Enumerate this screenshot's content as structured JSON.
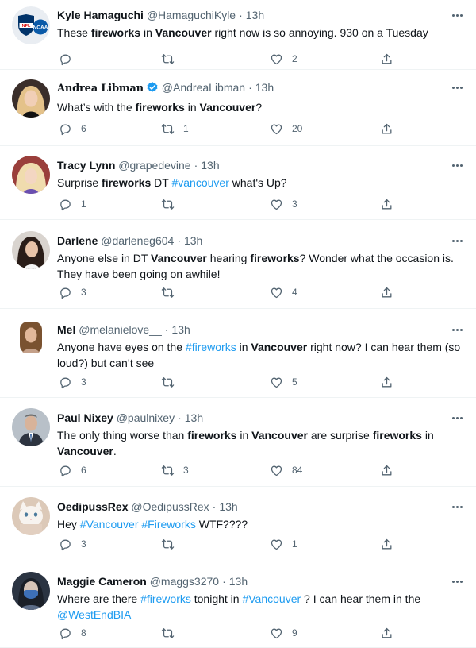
{
  "tweets": [
    {
      "name": "Kyle Hamaguchi",
      "handle": "@HamaguchiKyle",
      "time": "13h",
      "verified": false,
      "serif": false,
      "avatar": "nfl-ncaa-logo",
      "segments": [
        {
          "t": "These ",
          "s": "plain"
        },
        {
          "t": "fireworks",
          "s": "bold"
        },
        {
          "t": " in ",
          "s": "plain"
        },
        {
          "t": "Vancouver",
          "s": "bold"
        },
        {
          "t": " right now is so annoying. 930 on a Tuesday",
          "s": "plain"
        }
      ],
      "replies": "",
      "retweets": "",
      "likes": "2"
    },
    {
      "name": "Andrea Libman",
      "handle": "@AndreaLibman",
      "time": "13h",
      "verified": true,
      "serif": true,
      "avatar": "photo-blonde",
      "segments": [
        {
          "t": "What’s with the ",
          "s": "plain"
        },
        {
          "t": "fireworks",
          "s": "bold"
        },
        {
          "t": " in ",
          "s": "plain"
        },
        {
          "t": "Vancouver",
          "s": "bold"
        },
        {
          "t": "?",
          "s": "plain"
        }
      ],
      "replies": "6",
      "retweets": "1",
      "likes": "20"
    },
    {
      "name": "Tracy Lynn",
      "handle": "@grapedevine",
      "time": "13h",
      "verified": false,
      "serif": false,
      "avatar": "photo-blonde-2",
      "segments": [
        {
          "t": "Surprise ",
          "s": "plain"
        },
        {
          "t": "fireworks",
          "s": "bold"
        },
        {
          "t": " DT ",
          "s": "plain"
        },
        {
          "t": "#vancouver",
          "s": "tag"
        },
        {
          "t": " what's Up?",
          "s": "plain"
        }
      ],
      "replies": "1",
      "retweets": "",
      "likes": "3"
    },
    {
      "name": "Darlene",
      "handle": "@darleneg604",
      "time": "13h",
      "verified": false,
      "serif": false,
      "avatar": "photo-dark-hair",
      "segments": [
        {
          "t": "Anyone else in DT ",
          "s": "plain"
        },
        {
          "t": "Vancouver",
          "s": "bold"
        },
        {
          "t": " hearing ",
          "s": "plain"
        },
        {
          "t": "fireworks",
          "s": "bold"
        },
        {
          "t": "?  Wonder what the occasion is. They have been going on awhile!",
          "s": "plain"
        }
      ],
      "replies": "3",
      "retweets": "",
      "likes": "4"
    },
    {
      "name": "Mel",
      "handle": "@melanielove__",
      "time": "13h",
      "verified": false,
      "serif": false,
      "avatar": "photo-brown-hair",
      "segments": [
        {
          "t": "Anyone have eyes on the ",
          "s": "plain"
        },
        {
          "t": "#fireworks",
          "s": "tag"
        },
        {
          "t": " in ",
          "s": "plain"
        },
        {
          "t": "Vancouver",
          "s": "bold"
        },
        {
          "t": " right now? I can hear them (so loud?) but can’t see",
          "s": "plain"
        }
      ],
      "replies": "3",
      "retweets": "",
      "likes": "5"
    },
    {
      "name": "Paul Nixey",
      "handle": "@paulnixey",
      "time": "13h",
      "verified": false,
      "serif": false,
      "avatar": "photo-man-suit",
      "segments": [
        {
          "t": "The only thing worse than ",
          "s": "plain"
        },
        {
          "t": "fireworks",
          "s": "bold"
        },
        {
          "t": " in ",
          "s": "plain"
        },
        {
          "t": "Vancouver",
          "s": "bold"
        },
        {
          "t": " are surprise ",
          "s": "plain"
        },
        {
          "t": "fireworks",
          "s": "bold"
        },
        {
          "t": " in ",
          "s": "plain"
        },
        {
          "t": "Vancouver",
          "s": "bold"
        },
        {
          "t": ".",
          "s": "plain"
        }
      ],
      "replies": "6",
      "retweets": "3",
      "likes": "84"
    },
    {
      "name": "OedipussRex",
      "handle": "@OedipussRex",
      "time": "13h",
      "verified": false,
      "serif": false,
      "avatar": "photo-cat",
      "segments": [
        {
          "t": "Hey ",
          "s": "plain"
        },
        {
          "t": "#Vancouver",
          "s": "tag"
        },
        {
          "t": " ",
          "s": "plain"
        },
        {
          "t": "#Fireworks",
          "s": "tag"
        },
        {
          "t": " WTF????",
          "s": "plain"
        }
      ],
      "replies": "3",
      "retweets": "",
      "likes": "1"
    },
    {
      "name": "Maggie Cameron",
      "handle": "@maggs3270",
      "time": "13h",
      "verified": false,
      "serif": false,
      "avatar": "photo-masked",
      "segments": [
        {
          "t": "Where are there ",
          "s": "plain"
        },
        {
          "t": "#fireworks",
          "s": "tag"
        },
        {
          "t": " tonight in ",
          "s": "plain"
        },
        {
          "t": "#Vancouver",
          "s": "tag"
        },
        {
          "t": " ? I can hear them in the ",
          "s": "plain"
        },
        {
          "t": "@WestEndBIA",
          "s": "tag"
        }
      ],
      "replies": "8",
      "retweets": "",
      "likes": "9"
    }
  ],
  "colors": {
    "text": "#0f1419",
    "secondary": "#536471",
    "link": "#1d9bf0",
    "divider": "#eff3f4",
    "verified": "#1d9bf0"
  },
  "icons": {
    "reply": "reply-icon",
    "retweet": "retweet-icon",
    "like": "like-icon",
    "share": "share-icon",
    "more": "more-icon",
    "verified": "verified-badge-icon"
  }
}
